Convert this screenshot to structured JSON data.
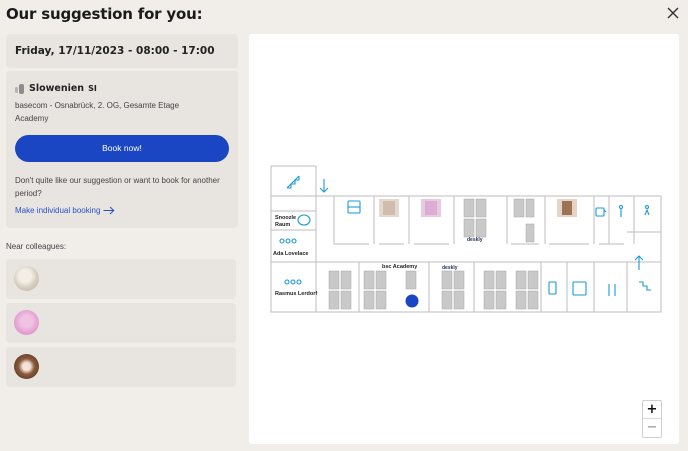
{
  "header": {
    "title": "Our suggestion for you:"
  },
  "booking": {
    "date_time": "Friday, 17/11/2023 - 08:00 - 17:00",
    "room": "Slowenien",
    "room_badge": "SI",
    "location": "basecom - Osnabrück, 2. OG, Gesamte Etage",
    "area": "Academy",
    "book_label": "Book now!",
    "alt_text": "Don't quite like our suggestion or want to book for another period?",
    "individual_link": "Make individual booking"
  },
  "colleagues": {
    "label": "Near colleagues:"
  },
  "map": {
    "rooms": [
      {
        "id": "snoozle",
        "label_line1": "Snoozle",
        "label_line2": "Raum"
      },
      {
        "id": "ada",
        "label": "Ada Lovelace"
      },
      {
        "id": "rasmus",
        "label": "Rasmus Lerdorf"
      },
      {
        "id": "bsc",
        "label": "bsc Academy"
      }
    ],
    "brand": "deskly",
    "zoom_in": "+",
    "zoom_out": "−"
  },
  "colors": {
    "accent": "#1a46c4",
    "map_icon": "#1a9ad6",
    "seat": "#c9c9c9"
  }
}
